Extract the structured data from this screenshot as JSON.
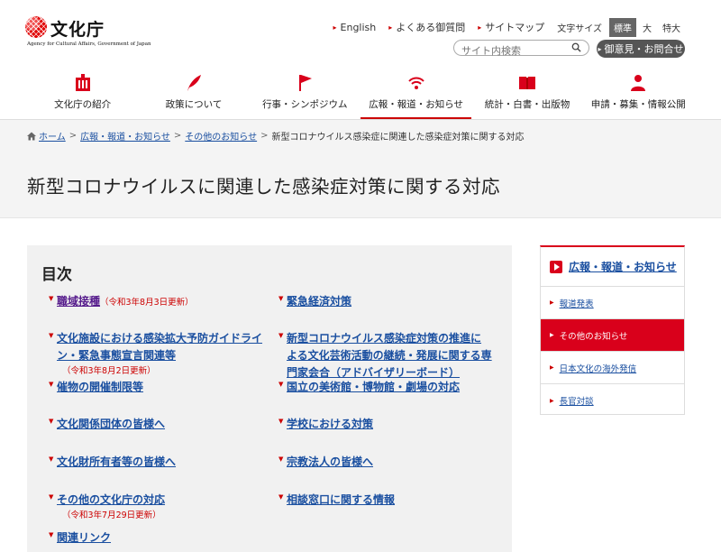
{
  "header": {
    "logo_text": "文化庁",
    "logo_sub": "Agency for Cultural Affairs, Government of Japan",
    "util_links": [
      "English",
      "よくある御質問",
      "サイトマップ"
    ],
    "text_size_label": "文字サイズ",
    "text_sizes": [
      "標準",
      "大",
      "特大"
    ],
    "text_size_selected": "標準",
    "search_placeholder": "サイト内検索",
    "contact_label": "御意見・お問合せ"
  },
  "gnav": [
    {
      "label": "文化庁の紹介",
      "icon": "building-icon"
    },
    {
      "label": "政策について",
      "icon": "quill-icon"
    },
    {
      "label": "行事・シンポジウム",
      "icon": "flag-icon"
    },
    {
      "label": "広報・報道・お知らせ",
      "icon": "broadcast-icon",
      "active": true
    },
    {
      "label": "統計・白書・出版物",
      "icon": "book-icon"
    },
    {
      "label": "申請・募集・情報公開",
      "icon": "person-icon"
    }
  ],
  "breadcrumb": {
    "home": "ホーム",
    "items": [
      "広報・報道・お知らせ",
      "その他のお知らせ"
    ],
    "current": "新型コロナウイルス感染症に関連した感染症対策に関する対応"
  },
  "page_title": "新型コロナウイルスに関連した感染症対策に関する対応",
  "toc": {
    "title": "目次",
    "left": [
      {
        "label": "職域接種",
        "note": "（令和3年8月3日更新）"
      },
      {
        "label": "文化施設における感染拡大予防ガイドライン・緊急事態宣言関連等",
        "note": "（令和3年8月2日更新）"
      },
      {
        "label": "催物の開催制限等",
        "note": ""
      },
      {
        "label": "文化関係団体の皆様へ",
        "note": ""
      },
      {
        "label": "文化財所有者等の皆様へ",
        "note": ""
      },
      {
        "label": "その他の文化庁の対応",
        "note": "（令和3年7月29日更新）"
      },
      {
        "label": "関連リンク",
        "note": ""
      }
    ],
    "right": [
      {
        "label": "緊急経済対策"
      },
      {
        "label": "新型コロナウイルス感染症対策の推進による文化芸術活動の継続・発展に関する専門家会合（アドバイザリーボード）"
      },
      {
        "label": "国立の美術館・博物館・劇場の対応"
      },
      {
        "label": "学校における対策"
      },
      {
        "label": "宗教法人の皆様へ"
      },
      {
        "label": "相談窓口に関する情報"
      }
    ]
  },
  "sidebar": {
    "heading": "広報・報道・お知らせ",
    "items": [
      "報道発表",
      "その他のお知らせ",
      "日本文化の海外発信",
      "長官対談"
    ],
    "active": "その他のお知らせ"
  },
  "colors": {
    "accent": "#d9001b",
    "link": "#1a4fa0"
  }
}
